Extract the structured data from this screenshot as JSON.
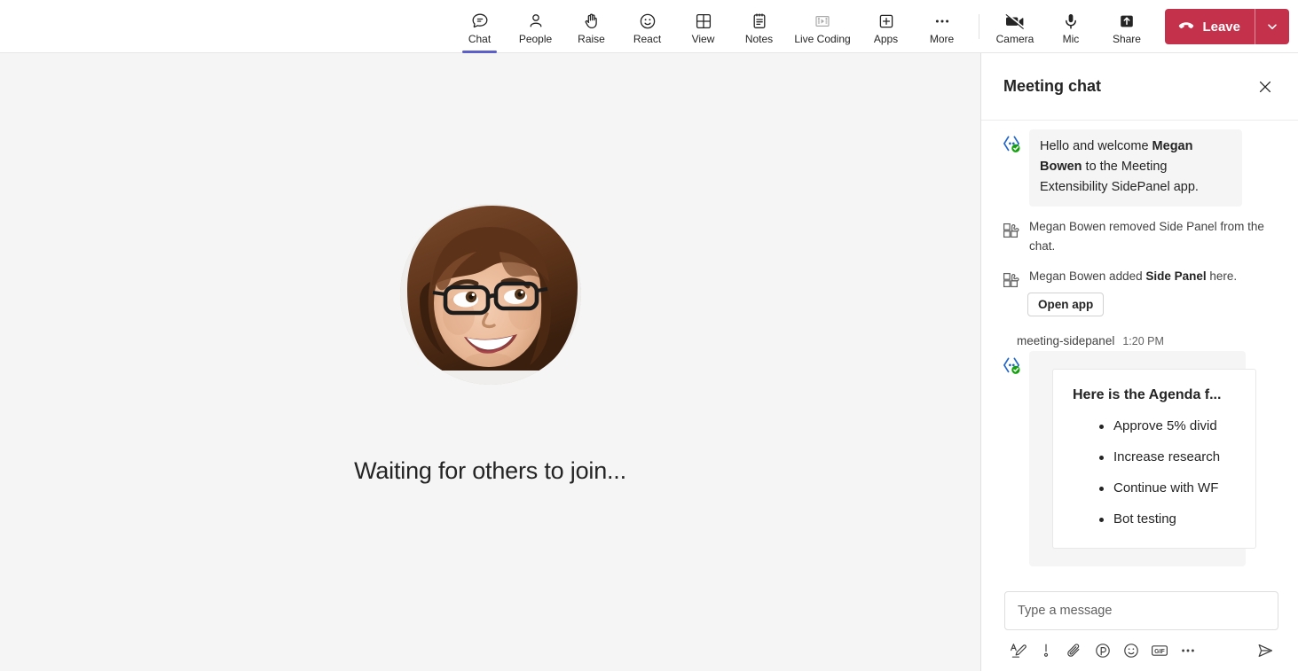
{
  "toolbar": {
    "items": [
      {
        "label": "Chat",
        "icon": "chat-icon",
        "active": true
      },
      {
        "label": "People",
        "icon": "people-icon",
        "active": false
      },
      {
        "label": "Raise",
        "icon": "raise-hand-icon",
        "active": false
      },
      {
        "label": "React",
        "icon": "react-icon",
        "active": false
      },
      {
        "label": "View",
        "icon": "view-grid-icon",
        "active": false
      },
      {
        "label": "Notes",
        "icon": "notes-icon",
        "active": false
      },
      {
        "label": "Live Coding",
        "icon": "live-coding-icon",
        "active": false
      },
      {
        "label": "Apps",
        "icon": "apps-plus-icon",
        "active": false
      },
      {
        "label": "More",
        "icon": "more-ellipsis-icon",
        "active": false
      }
    ],
    "device_items": [
      {
        "label": "Camera",
        "icon": "camera-off-icon"
      },
      {
        "label": "Mic",
        "icon": "mic-icon"
      },
      {
        "label": "Share",
        "icon": "share-up-icon"
      }
    ],
    "leave_label": "Leave",
    "leave_color": "#c4314b",
    "active_indicator_color": "#5b5fc7"
  },
  "stage": {
    "waiting_text": "Waiting for others to join...",
    "avatar_name": "Megan Bowen",
    "background_color": "#f5f5f5"
  },
  "chat": {
    "title": "Meeting chat",
    "close_label": "Close",
    "messages": [
      {
        "type": "bot-bubble",
        "icon": "bot-app-icon",
        "text_prefix": "Hello and welcome ",
        "text_bold": "Megan Bowen",
        "text_suffix": " to the Meeting Extensibility SidePanel app."
      },
      {
        "type": "system",
        "icon": "apps-puzzle-icon",
        "text_prefix": "Megan Bowen removed Side Panel from the chat.",
        "text_bold": "",
        "text_suffix": ""
      },
      {
        "type": "system-action",
        "icon": "apps-puzzle-icon",
        "text_prefix": "Megan Bowen added ",
        "text_bold": "Side Panel",
        "text_suffix": " here.",
        "button_label": "Open app"
      }
    ],
    "card_message": {
      "sender": "meeting-sidepanel",
      "timestamp": "1:20 PM",
      "icon": "bot-app-icon",
      "card": {
        "title": "Here is the Agenda f...",
        "items": [
          "Approve 5% divid",
          "Increase research",
          "Continue with WF",
          "Bot testing"
        ]
      }
    },
    "composer": {
      "placeholder": "Type a message",
      "value": "",
      "tools": [
        {
          "name": "format-icon"
        },
        {
          "name": "importance-icon"
        },
        {
          "name": "attach-icon"
        },
        {
          "name": "loop-icon"
        },
        {
          "name": "emoji-icon"
        },
        {
          "name": "gif-icon"
        },
        {
          "name": "more-ellipsis-icon"
        }
      ],
      "gif_label": "GIF",
      "send_name": "send-icon"
    }
  }
}
